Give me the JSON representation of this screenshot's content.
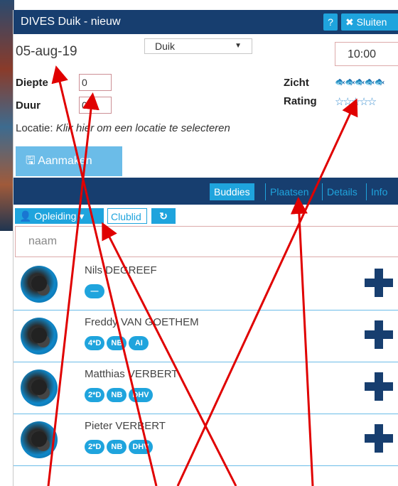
{
  "window": {
    "title": "DIVES Duik - nieuw",
    "help_label": "?",
    "close_label": "✖ Sluiten"
  },
  "form": {
    "date": "05-aug-19",
    "dive_type": "Duik",
    "time": "10:00",
    "depth_label": "Diepte",
    "depth_value": "0",
    "duration_label": "Duur",
    "duration_value": "0",
    "visibility_label": "Zicht",
    "visibility_icons": "🐟🐟🐟🐟🐟",
    "rating_label": "Rating",
    "rating_icons": "☆☆☆☆☆",
    "location_label": "Locatie:",
    "location_hint": " Klik hier om een locatie te selecteren",
    "create_label": "🖫 Aanmaken"
  },
  "tabs": [
    {
      "label": "Buddies",
      "active": true
    },
    {
      "label": "Plaatsen",
      "active": false
    },
    {
      "label": "Details",
      "active": false
    },
    {
      "label": "Info",
      "active": false
    }
  ],
  "filters": {
    "opleiding_label": "👤 Opleiding ▾",
    "clublid_label": "Clublid",
    "reset_label": "↻"
  },
  "search": {
    "placeholder": "naam"
  },
  "buddies": [
    {
      "name": "Nils DEGREEF",
      "badges": [
        "—"
      ]
    },
    {
      "name": "Freddy VAN GOETHEM",
      "badges": [
        "4*D",
        "NB",
        "AI"
      ]
    },
    {
      "name": "Matthias VERBERT",
      "badges": [
        "2*D",
        "NB",
        "DHV"
      ]
    },
    {
      "name": "Pieter VERBERT",
      "badges": [
        "2*D",
        "NB",
        "DHV"
      ]
    }
  ],
  "colors": {
    "primary": "#173e6f",
    "accent": "#1fa4dd",
    "annotation": "#e00000"
  }
}
